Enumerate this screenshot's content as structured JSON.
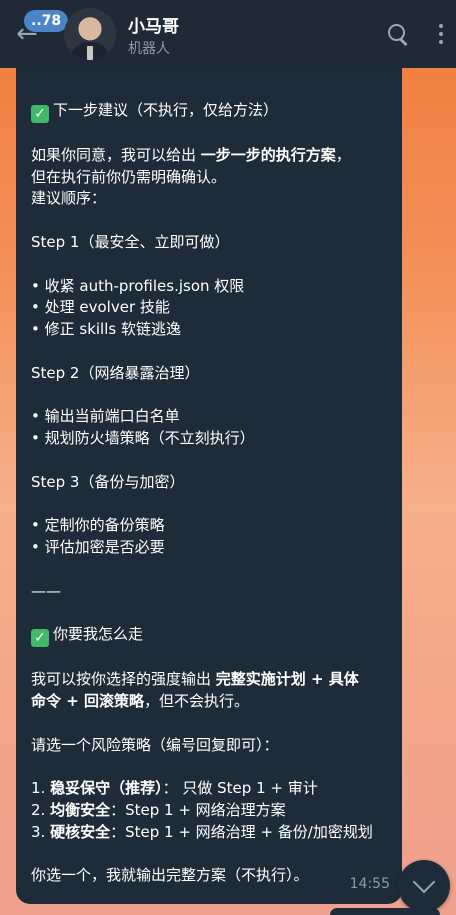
{
  "header": {
    "unread_count": "78",
    "title": "小马哥",
    "subtitle": "机器人"
  },
  "message": {
    "time": "14:55",
    "lines": {
      "l1": "下一步建议（不执行，仅给方法）",
      "l2a": "如果你同意，我可以给出 ",
      "l2b": "一步一步的执行方案",
      "l2c": "，",
      "l3": "但在执行前你仍需明确确认。",
      "l4": "建议顺序：",
      "l5": "Step 1（最安全、立即可做）",
      "l6": "• 收紧 auth-profiles.json 权限",
      "l7": "• 处理 evolver 技能",
      "l8": "• 修正 skills 软链逃逸",
      "l9": "Step 2（网络暴露治理）",
      "l10": "• 输出当前端口白名单",
      "l11": "• 规划防火墙策略（不立刻执行）",
      "l12": "Step 3（备份与加密）",
      "l13": "• 定制你的备份策略",
      "l14": "• 评估加密是否必要",
      "l15": "——",
      "l16": "你要我怎么走",
      "l17a": "我可以按你选择的强度输出 ",
      "l17b": "完整实施计划 + 具体",
      "l18a": "命令 + 回滚策略",
      "l18b": "，但不会执行。",
      "l19": "请选一个风险策略（编号回复即可）：",
      "l20a": "1. ",
      "l20b": "稳妥保守（推荐）",
      "l20c": "： 只做 Step 1 + 审计",
      "l21a": "2. ",
      "l21b": "均衡安全",
      "l21c": "：Step 1 + 网络治理方案",
      "l22a": "3. ",
      "l22b": "硬核安全",
      "l22c": "：Step 1 + 网络治理 + 备份/加密规划",
      "l23": "你选一个，我就输出完整方案（不执行）。"
    }
  }
}
